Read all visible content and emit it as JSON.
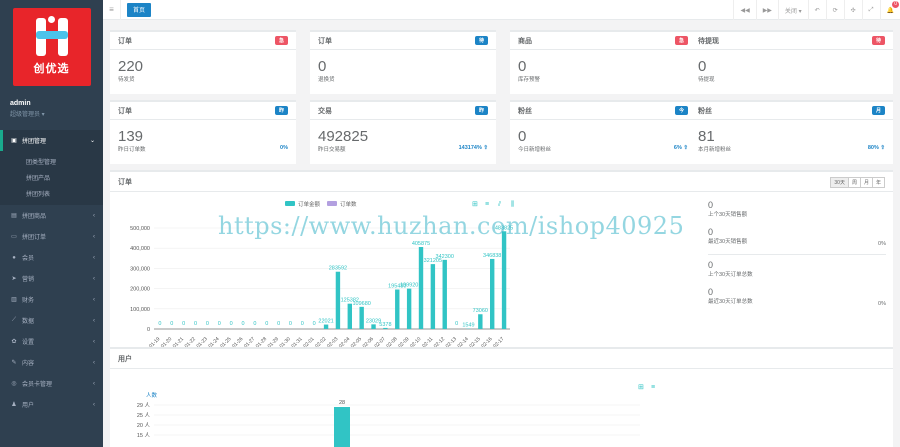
{
  "brand": {
    "logo_text": "创优选",
    "logo_color": "#e8252a"
  },
  "profile": {
    "name": "admin",
    "role": "超级管理员 ▾"
  },
  "sidebar": {
    "items": [
      {
        "label": "拼团管理",
        "icon": "group-icon",
        "active": true
      },
      {
        "label": "拼团商品",
        "icon": "goods-icon"
      },
      {
        "label": "拼团订单",
        "icon": "order-icon"
      },
      {
        "label": "会员",
        "icon": "user-icon"
      },
      {
        "label": "营销",
        "icon": "send-icon"
      },
      {
        "label": "财务",
        "icon": "money-icon"
      },
      {
        "label": "数据",
        "icon": "chart-icon"
      },
      {
        "label": "设置",
        "icon": "gear-icon"
      },
      {
        "label": "内容",
        "icon": "doc-icon"
      },
      {
        "label": "会员卡管理",
        "icon": "card-icon"
      },
      {
        "label": "用户",
        "icon": "person-icon"
      }
    ],
    "submenu": [
      "团类型管理",
      "拼团产品",
      "拼团列表"
    ]
  },
  "topbar": {
    "tab": "首页",
    "tools": [
      "◀◀",
      "▶▶",
      "关闭 ▾",
      "↶",
      "⟳",
      "✣",
      "⤢",
      "🔔"
    ],
    "badge": "0"
  },
  "stats_row1": [
    {
      "title": "订单",
      "label": "急",
      "label_color": "#ed5565",
      "value": "220",
      "desc": "待发货"
    },
    {
      "title": "订单",
      "label": "待",
      "label_color": "#1c84c6",
      "value": "0",
      "desc": "退换货"
    },
    {
      "title": "商品",
      "label": "急",
      "label_color": "#ed5565",
      "value": "0",
      "desc": "库存预警"
    },
    {
      "title": "待提现",
      "label": "待",
      "label_color": "#ed5565",
      "value": "0",
      "desc": "待提现"
    }
  ],
  "stats_row2": [
    {
      "title": "订单",
      "label": "昨",
      "label_color": "#1c84c6",
      "value": "139",
      "desc": "昨日订单数",
      "pct": "0%"
    },
    {
      "title": "交易",
      "label": "昨",
      "label_color": "#1c84c6",
      "value": "492825",
      "desc": "昨日交易额",
      "pct": "143174% ⇧"
    },
    {
      "title": "粉丝",
      "label": "今",
      "label_color": "#1c84c6",
      "value": "0",
      "desc": "今日新增粉丝",
      "pct": "6% ⇧"
    },
    {
      "title": "粉丝",
      "label": "月",
      "label_color": "#1c84c6",
      "value": "81",
      "desc": "本月新增粉丝",
      "pct": "80% ⇧"
    }
  ],
  "orders_panel": {
    "title": "订单",
    "ranges": [
      "30天",
      "周",
      "月",
      "年"
    ],
    "legend": [
      "订单金额",
      "订单数"
    ],
    "side": [
      {
        "value": "0",
        "desc": "上个30天销售额",
        "pct": ""
      },
      {
        "value": "0",
        "desc": "最近30天销售额",
        "pct": "0%"
      },
      {
        "value": "0",
        "desc": "上个30天订单总数",
        "pct": ""
      },
      {
        "value": "0",
        "desc": "最近30天订单总数",
        "pct": "0%"
      }
    ]
  },
  "users_panel": {
    "title": "用户",
    "ylabel": "人数"
  },
  "watermark": "https://www.huzhan.com/ishop40925",
  "chart_data": [
    {
      "type": "bar",
      "title": "",
      "categories": [
        "01-19",
        "01-20",
        "01-21",
        "01-22",
        "01-23",
        "01-24",
        "01-25",
        "01-26",
        "01-27",
        "01-28",
        "01-29",
        "01-30",
        "01-31",
        "02-01",
        "02-02",
        "02-03",
        "02-04",
        "02-05",
        "02-06",
        "02-07",
        "02-08",
        "02-09",
        "02-10",
        "02-11",
        "02-12",
        "02-13",
        "02-14",
        "02-15",
        "02-16",
        "02-17"
      ],
      "series": [
        {
          "name": "订单金额",
          "values": [
            0,
            0,
            0,
            0,
            0,
            0,
            0,
            0,
            0,
            0,
            0,
            0,
            0,
            0,
            22021,
            283592,
            125382,
            109680,
            23029,
            5378,
            195480,
            199920,
            405875,
            321205,
            342300,
            0,
            1549,
            73060,
            346838,
            483825
          ]
        },
        {
          "name": "订单数",
          "values": [
            0,
            0,
            0,
            0,
            0,
            0,
            0,
            0,
            0,
            0,
            0,
            0,
            0,
            0,
            0,
            0,
            0,
            0,
            0,
            0,
            0,
            0,
            0,
            0,
            0,
            0,
            0,
            0,
            0,
            0
          ]
        }
      ],
      "data_labels": [
        "0",
        "0",
        "0",
        "0",
        "0",
        "0",
        "0",
        "0",
        "0",
        "0",
        "0",
        "0",
        "0",
        "0",
        "22021",
        "283592",
        "125382",
        "109680",
        "23029",
        "5378",
        "195480",
        "199920",
        "405875",
        "321205",
        "342300",
        "0",
        "1549",
        "73060",
        "346838",
        "483825"
      ],
      "yticks": [
        "0",
        "100,000",
        "200,000",
        "300,000",
        "400,000",
        "500,000"
      ],
      "ylim": [
        0,
        500000
      ],
      "colors": [
        "#31c4c5",
        "#b3a0e0"
      ]
    },
    {
      "type": "bar",
      "title": "",
      "ylabel": "人数",
      "yticks": [
        "15 人",
        "20 人",
        "25 人",
        "29 人"
      ],
      "values": [
        28
      ],
      "data_labels": [
        "28"
      ],
      "color": "#31c4c5"
    }
  ]
}
